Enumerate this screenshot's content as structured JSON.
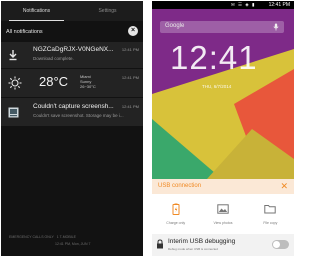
{
  "left": {
    "tabs": [
      {
        "label": "Notifications",
        "active": true
      },
      {
        "label": "Settings",
        "active": false
      }
    ],
    "header_label": "All notifications",
    "clear_icon": "clear-all-icon",
    "notifications": [
      {
        "icon": "download-icon",
        "title": "NGZCaDgRJX-V0NGeNX...",
        "text": "Download complete.",
        "time": "12:41 PM"
      },
      {
        "icon": "sun-icon",
        "temperature": "28°C",
        "location": "Miami",
        "condition": "Sunny",
        "range": "26~30°C",
        "time": "12:41 PM"
      },
      {
        "icon": "screenshot-icon",
        "title": "Couldn't capture screensh...",
        "text": "Couldn't save screenshot. Storage may be i...",
        "time": "12:41 PM"
      }
    ],
    "footer_carrier": "EMERGENCY CALLS ONLY",
    "footer_sim": "1 T-MOBILE",
    "footer_time": "12:41 PM, Mon, JUN 7"
  },
  "right": {
    "status_time": "12:41 PM",
    "status_icons": "✉ ☰ ◈ ▮",
    "search_placeholder": "Google",
    "clock": "12:41",
    "date": "THU, 6/7/2014",
    "colors": {
      "accent": "#f08a24",
      "wallpaper": [
        "#7e2a88",
        "#d8c23a",
        "#3aa86b",
        "#e8573b"
      ]
    },
    "usb": {
      "title": "USB connection",
      "close_icon": "close-icon",
      "options": [
        {
          "icon": "battery-charge-icon",
          "label": "Charge only"
        },
        {
          "icon": "photo-icon",
          "label": "View photos"
        },
        {
          "icon": "folder-icon",
          "label": "File copy"
        }
      ],
      "debug_label": "Interim USB debugging",
      "debug_desc": "Debug mode when USB is connected",
      "debug_enabled": false
    }
  }
}
